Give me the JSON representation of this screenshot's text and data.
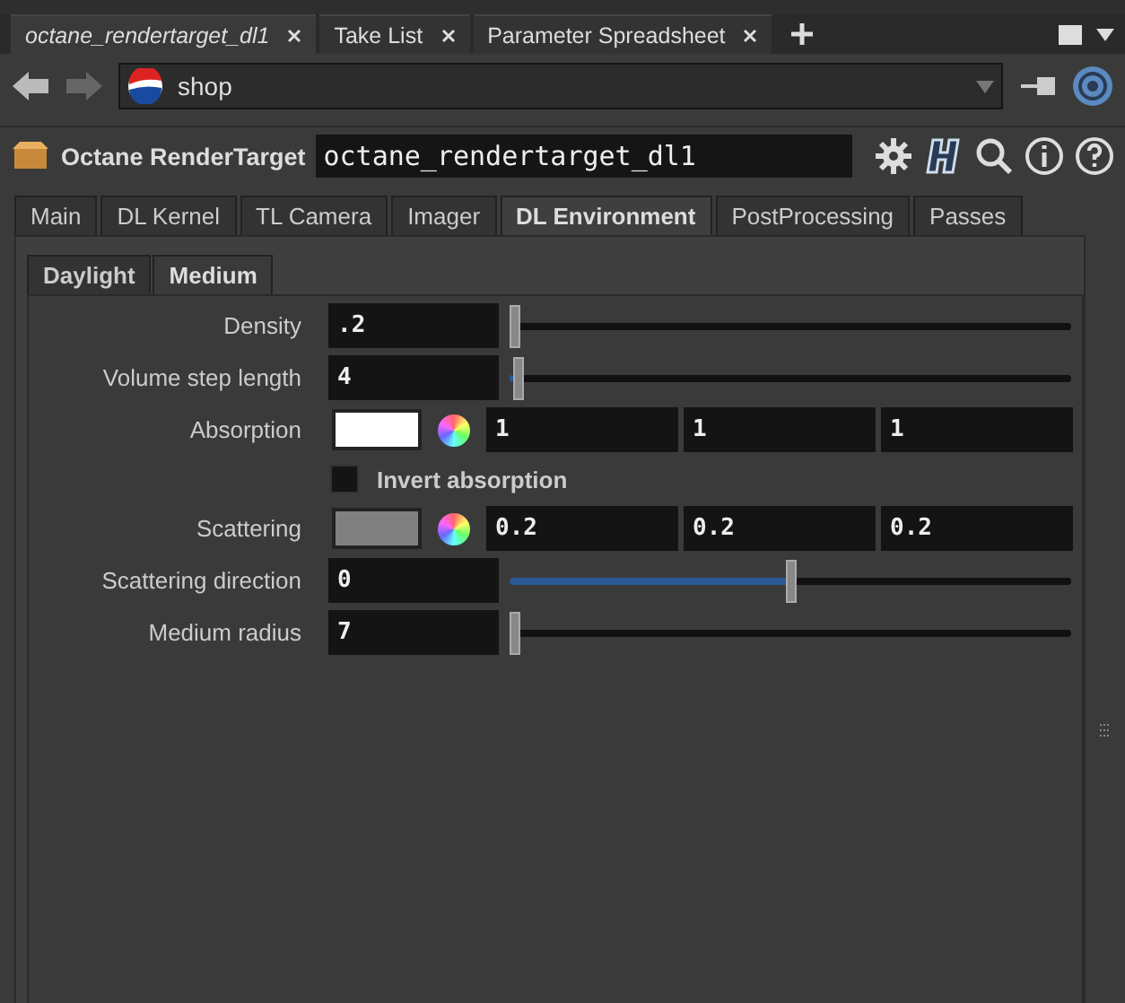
{
  "pane_tabs": [
    {
      "label": "octane_rendertarget_dl1",
      "selected": true
    },
    {
      "label": "Take List",
      "selected": false
    },
    {
      "label": "Parameter Spreadsheet",
      "selected": false
    }
  ],
  "path": {
    "value": "shop"
  },
  "node": {
    "type": "Octane RenderTarget",
    "name": "octane_rendertarget_dl1"
  },
  "tabs": [
    {
      "label": "Main",
      "selected": false
    },
    {
      "label": "DL Kernel",
      "selected": false
    },
    {
      "label": "TL Camera",
      "selected": false
    },
    {
      "label": "Imager",
      "selected": false
    },
    {
      "label": "DL Environment",
      "selected": true
    },
    {
      "label": "PostProcessing",
      "selected": false
    },
    {
      "label": "Passes",
      "selected": false
    }
  ],
  "subtabs": [
    {
      "label": "Daylight",
      "selected": false
    },
    {
      "label": "Medium",
      "selected": true
    }
  ],
  "params": [
    {
      "kind": "slider",
      "label": "Density",
      "value": ".2",
      "level": 0
    },
    {
      "kind": "slider",
      "label": "Volume step length",
      "value": "4",
      "level": 0.005
    },
    {
      "kind": "color",
      "label": "Absorption",
      "color": "#ffffff",
      "values": [
        "1",
        "1",
        "1"
      ]
    },
    {
      "kind": "checkbox",
      "label": "Invert absorption",
      "checked": false
    },
    {
      "kind": "color",
      "label": "Scattering",
      "color": "#808080",
      "values": [
        "0.2",
        "0.2",
        "0.2"
      ]
    },
    {
      "kind": "slider",
      "label": "Scattering direction",
      "value": "0",
      "level": 0.5
    },
    {
      "kind": "slider",
      "label": "Medium radius",
      "value": "7",
      "level": 0
    }
  ]
}
